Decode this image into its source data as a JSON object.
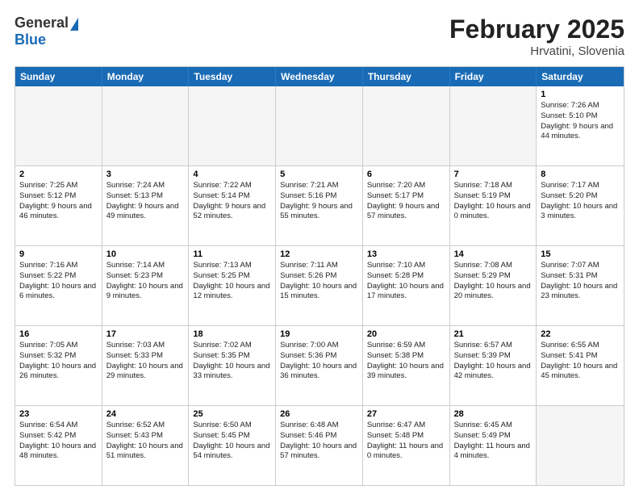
{
  "header": {
    "logo_general": "General",
    "logo_blue": "Blue",
    "month_title": "February 2025",
    "location": "Hrvatini, Slovenia"
  },
  "days_of_week": [
    "Sunday",
    "Monday",
    "Tuesday",
    "Wednesday",
    "Thursday",
    "Friday",
    "Saturday"
  ],
  "weeks": [
    [
      {
        "day": "",
        "info": "",
        "empty": true
      },
      {
        "day": "",
        "info": "",
        "empty": true
      },
      {
        "day": "",
        "info": "",
        "empty": true
      },
      {
        "day": "",
        "info": "",
        "empty": true
      },
      {
        "day": "",
        "info": "",
        "empty": true
      },
      {
        "day": "",
        "info": "",
        "empty": true
      },
      {
        "day": "1",
        "info": "Sunrise: 7:26 AM\nSunset: 5:10 PM\nDaylight: 9 hours and 44 minutes.",
        "empty": false
      }
    ],
    [
      {
        "day": "2",
        "info": "Sunrise: 7:25 AM\nSunset: 5:12 PM\nDaylight: 9 hours and 46 minutes.",
        "empty": false
      },
      {
        "day": "3",
        "info": "Sunrise: 7:24 AM\nSunset: 5:13 PM\nDaylight: 9 hours and 49 minutes.",
        "empty": false
      },
      {
        "day": "4",
        "info": "Sunrise: 7:22 AM\nSunset: 5:14 PM\nDaylight: 9 hours and 52 minutes.",
        "empty": false
      },
      {
        "day": "5",
        "info": "Sunrise: 7:21 AM\nSunset: 5:16 PM\nDaylight: 9 hours and 55 minutes.",
        "empty": false
      },
      {
        "day": "6",
        "info": "Sunrise: 7:20 AM\nSunset: 5:17 PM\nDaylight: 9 hours and 57 minutes.",
        "empty": false
      },
      {
        "day": "7",
        "info": "Sunrise: 7:18 AM\nSunset: 5:19 PM\nDaylight: 10 hours and 0 minutes.",
        "empty": false
      },
      {
        "day": "8",
        "info": "Sunrise: 7:17 AM\nSunset: 5:20 PM\nDaylight: 10 hours and 3 minutes.",
        "empty": false
      }
    ],
    [
      {
        "day": "9",
        "info": "Sunrise: 7:16 AM\nSunset: 5:22 PM\nDaylight: 10 hours and 6 minutes.",
        "empty": false
      },
      {
        "day": "10",
        "info": "Sunrise: 7:14 AM\nSunset: 5:23 PM\nDaylight: 10 hours and 9 minutes.",
        "empty": false
      },
      {
        "day": "11",
        "info": "Sunrise: 7:13 AM\nSunset: 5:25 PM\nDaylight: 10 hours and 12 minutes.",
        "empty": false
      },
      {
        "day": "12",
        "info": "Sunrise: 7:11 AM\nSunset: 5:26 PM\nDaylight: 10 hours and 15 minutes.",
        "empty": false
      },
      {
        "day": "13",
        "info": "Sunrise: 7:10 AM\nSunset: 5:28 PM\nDaylight: 10 hours and 17 minutes.",
        "empty": false
      },
      {
        "day": "14",
        "info": "Sunrise: 7:08 AM\nSunset: 5:29 PM\nDaylight: 10 hours and 20 minutes.",
        "empty": false
      },
      {
        "day": "15",
        "info": "Sunrise: 7:07 AM\nSunset: 5:31 PM\nDaylight: 10 hours and 23 minutes.",
        "empty": false
      }
    ],
    [
      {
        "day": "16",
        "info": "Sunrise: 7:05 AM\nSunset: 5:32 PM\nDaylight: 10 hours and 26 minutes.",
        "empty": false
      },
      {
        "day": "17",
        "info": "Sunrise: 7:03 AM\nSunset: 5:33 PM\nDaylight: 10 hours and 29 minutes.",
        "empty": false
      },
      {
        "day": "18",
        "info": "Sunrise: 7:02 AM\nSunset: 5:35 PM\nDaylight: 10 hours and 33 minutes.",
        "empty": false
      },
      {
        "day": "19",
        "info": "Sunrise: 7:00 AM\nSunset: 5:36 PM\nDaylight: 10 hours and 36 minutes.",
        "empty": false
      },
      {
        "day": "20",
        "info": "Sunrise: 6:59 AM\nSunset: 5:38 PM\nDaylight: 10 hours and 39 minutes.",
        "empty": false
      },
      {
        "day": "21",
        "info": "Sunrise: 6:57 AM\nSunset: 5:39 PM\nDaylight: 10 hours and 42 minutes.",
        "empty": false
      },
      {
        "day": "22",
        "info": "Sunrise: 6:55 AM\nSunset: 5:41 PM\nDaylight: 10 hours and 45 minutes.",
        "empty": false
      }
    ],
    [
      {
        "day": "23",
        "info": "Sunrise: 6:54 AM\nSunset: 5:42 PM\nDaylight: 10 hours and 48 minutes.",
        "empty": false
      },
      {
        "day": "24",
        "info": "Sunrise: 6:52 AM\nSunset: 5:43 PM\nDaylight: 10 hours and 51 minutes.",
        "empty": false
      },
      {
        "day": "25",
        "info": "Sunrise: 6:50 AM\nSunset: 5:45 PM\nDaylight: 10 hours and 54 minutes.",
        "empty": false
      },
      {
        "day": "26",
        "info": "Sunrise: 6:48 AM\nSunset: 5:46 PM\nDaylight: 10 hours and 57 minutes.",
        "empty": false
      },
      {
        "day": "27",
        "info": "Sunrise: 6:47 AM\nSunset: 5:48 PM\nDaylight: 11 hours and 0 minutes.",
        "empty": false
      },
      {
        "day": "28",
        "info": "Sunrise: 6:45 AM\nSunset: 5:49 PM\nDaylight: 11 hours and 4 minutes.",
        "empty": false
      },
      {
        "day": "",
        "info": "",
        "empty": true
      }
    ]
  ]
}
